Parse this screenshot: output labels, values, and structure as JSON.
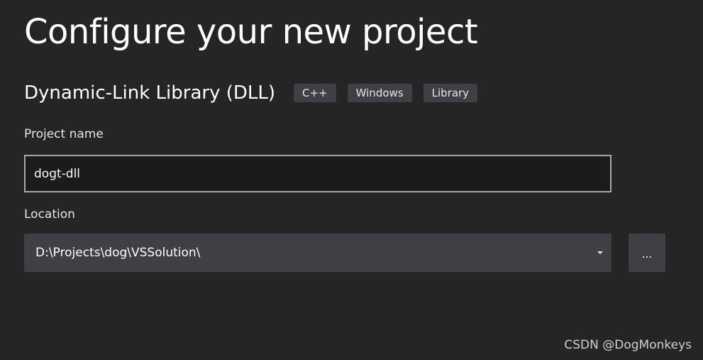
{
  "page": {
    "title": "Configure your new project"
  },
  "template": {
    "name": "Dynamic-Link Library (DLL)",
    "tags": [
      "C++",
      "Windows",
      "Library"
    ]
  },
  "form": {
    "project_name_label": "Project name",
    "project_name_value": "dogt-dll",
    "location_label": "Location",
    "location_value": "D:\\Projects\\dog\\VSSolution\\",
    "browse_label": "..."
  },
  "watermark": "CSDN @DogMonkeys",
  "icons": {
    "location_dropdown": "chevron-down-icon"
  },
  "colors": {
    "background": "#252526",
    "tag_background": "#3f3f46",
    "input_border": "#a8a8a8"
  }
}
